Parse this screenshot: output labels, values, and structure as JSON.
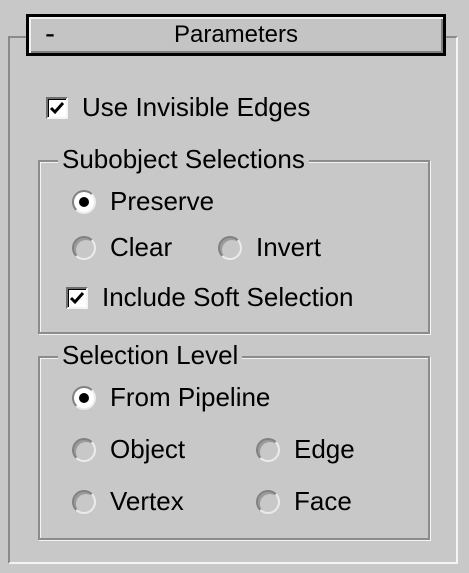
{
  "rollout": {
    "toggle": "-",
    "title": "Parameters"
  },
  "use_invisible_edges": {
    "label": "Use Invisible Edges",
    "checked": true
  },
  "subobject_selections": {
    "legend": "Subobject Selections",
    "preserve": {
      "label": "Preserve",
      "checked": true
    },
    "clear": {
      "label": "Clear",
      "checked": false
    },
    "invert": {
      "label": "Invert",
      "checked": false
    },
    "include_soft_selection": {
      "label": "Include Soft Selection",
      "checked": true
    }
  },
  "selection_level": {
    "legend": "Selection Level",
    "from_pipeline": {
      "label": "From Pipeline",
      "checked": true
    },
    "object": {
      "label": "Object",
      "checked": false
    },
    "edge": {
      "label": "Edge",
      "checked": false
    },
    "vertex": {
      "label": "Vertex",
      "checked": false
    },
    "face": {
      "label": "Face",
      "checked": false
    }
  }
}
